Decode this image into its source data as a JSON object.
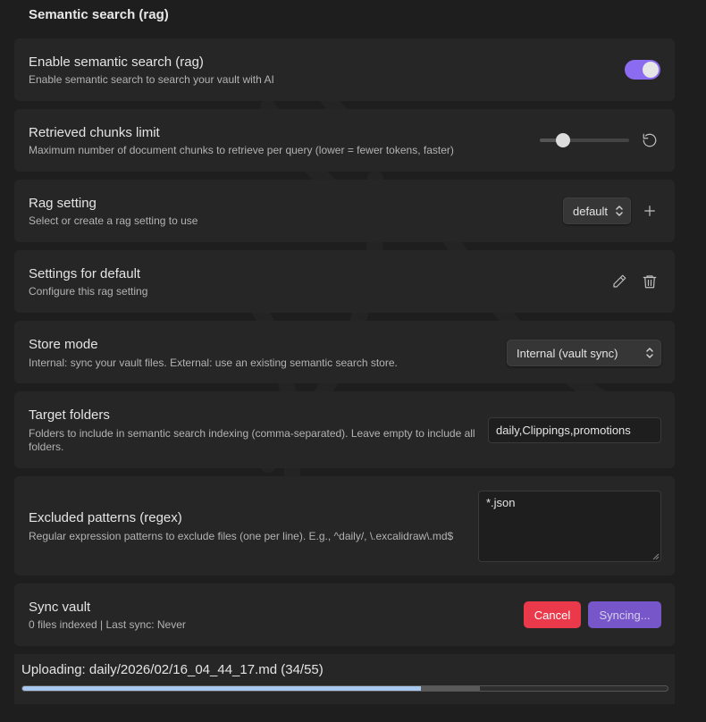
{
  "section": {
    "heading": "Semantic search (rag)"
  },
  "enable_rag": {
    "title": "Enable semantic search (rag)",
    "description": "Enable semantic search to search your vault with AI",
    "enabled": true
  },
  "chunks_limit": {
    "title": "Retrieved chunks limit",
    "description": "Maximum number of document chunks to retrieve per query (lower = fewer tokens, faster)",
    "slider_fraction": 0.26
  },
  "rag_setting": {
    "title": "Rag setting",
    "description": "Select or create a rag setting to use",
    "selected": "default"
  },
  "settings_for_default": {
    "title": "Settings for default",
    "description": "Configure this rag setting"
  },
  "store_mode": {
    "title": "Store mode",
    "description": "Internal: sync your vault files. External: use an existing semantic search store.",
    "selected": "Internal (vault sync)"
  },
  "target_folders": {
    "title": "Target folders",
    "description": "Folders to include in semantic search indexing (comma-separated). Leave empty to include all folders.",
    "value": "daily,Clippings,promotions"
  },
  "excluded_patterns": {
    "title": "Excluded patterns (regex)",
    "description": "Regular expression patterns to exclude files (one per line). E.g., ^daily/, \\.excalidraw\\.md$",
    "value": "*.json"
  },
  "sync_vault": {
    "title": "Sync vault",
    "status": "0 files indexed | Last sync: Never",
    "cancel_label": "Cancel",
    "sync_label": "Syncing..."
  },
  "progress": {
    "label": "Uploading: daily/2026/02/16_04_44_17.md (34/55)",
    "fraction": 0.618,
    "buffer_fraction": 0.709
  },
  "colors": {
    "accent": "#8b6cf0",
    "danger": "#e9394a",
    "sync_button": "#7656c9",
    "progress": "#a8c8f0"
  }
}
